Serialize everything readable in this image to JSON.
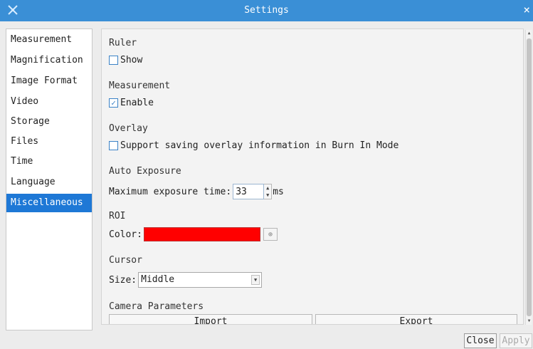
{
  "window": {
    "title": "Settings",
    "app_icon": "tool-icon",
    "close_symbol": "×"
  },
  "nav": {
    "items": [
      {
        "label": "Measurement"
      },
      {
        "label": "Magnification"
      },
      {
        "label": "Image Format"
      },
      {
        "label": "Video"
      },
      {
        "label": "Storage"
      },
      {
        "label": "Files"
      },
      {
        "label": "Time"
      },
      {
        "label": "Language"
      },
      {
        "label": "Miscellaneous"
      }
    ],
    "selected": "Miscellaneous"
  },
  "sections": {
    "ruler": {
      "title": "Ruler",
      "checkbox_label": "Show",
      "checked": false
    },
    "measurement": {
      "title": "Measurement",
      "checkbox_label": "Enable",
      "checked": true,
      "check_mark": "✓"
    },
    "overlay": {
      "title": "Overlay",
      "checkbox_label": "Support saving overlay information in Burn In Mode",
      "checked": false
    },
    "auto_exposure": {
      "title": "Auto Exposure",
      "field_label": "Maximum exposure time:",
      "value": "33",
      "unit": "ms"
    },
    "roi": {
      "title": "ROI",
      "color_label": "Color:",
      "color": "#ff0000"
    },
    "cursor": {
      "title": "Cursor",
      "size_label": "Size:",
      "size_value": "Middle"
    },
    "camera_parameters": {
      "title": "Camera Parameters",
      "import_label": "Import",
      "export_label": "Export"
    }
  },
  "buttons": {
    "close": "Close",
    "apply": "Apply"
  },
  "colors": {
    "titlebar": "#3a8fd6",
    "selected": "#1e78d6",
    "roi_color": "#ff0000"
  }
}
